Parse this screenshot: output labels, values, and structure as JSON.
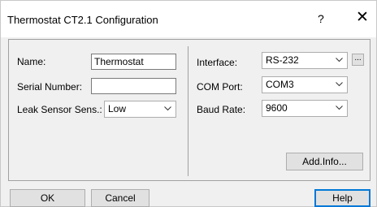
{
  "dialog": {
    "title": "Thermostat CT2.1 Configuration",
    "help_glyph": "?",
    "close_glyph": "✕"
  },
  "fields": {
    "name_label": "Name:",
    "name_value": "Thermostat",
    "serial_label": "Serial Number:",
    "serial_value": "",
    "leak_label": "Leak Sensor Sens.:",
    "leak_value": "Low",
    "interface_label": "Interface:",
    "interface_value": "RS-232",
    "interface_extra_button": "...",
    "com_label": "COM Port:",
    "com_value": "COM3",
    "baud_label": "Baud Rate:",
    "baud_value": "9600"
  },
  "buttons": {
    "add_info": "Add.Info...",
    "ok": "OK",
    "cancel": "Cancel",
    "help": "Help"
  },
  "icons": {
    "dropdown": "chevron-down-icon",
    "close": "close-icon",
    "help": "help-icon"
  }
}
